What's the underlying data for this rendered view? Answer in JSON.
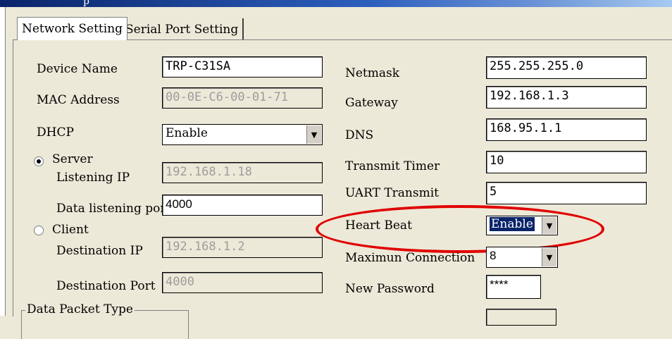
{
  "window": {
    "title_glyph": "p"
  },
  "tabs": [
    {
      "label": "Network Setting",
      "active": true
    },
    {
      "label": "Serial Port Setting",
      "active": false
    }
  ],
  "left": {
    "device_name": {
      "label": "Device Name",
      "value": "TRP-C31SA"
    },
    "mac_address": {
      "label": "MAC Address",
      "value": "00-0E-C6-00-01-71"
    },
    "dhcp": {
      "label": "DHCP",
      "value": "Enable"
    },
    "server": {
      "label": "Server",
      "selected": true
    },
    "listening_ip": {
      "label": "Listening IP",
      "value": "192.168.1.18"
    },
    "data_listening_port": {
      "label": "Data listening port",
      "value": "4000"
    },
    "client": {
      "label": "Client",
      "selected": false
    },
    "destination_ip": {
      "label": "Destination IP",
      "value": "192.168.1.2"
    },
    "destination_port": {
      "label": "Destination Port",
      "value": "4000"
    },
    "data_packet_type": {
      "label": "Data Packet Type"
    }
  },
  "right": {
    "netmask": {
      "label": "Netmask",
      "value": "255.255.255.0"
    },
    "gateway": {
      "label": "Gateway",
      "value": "192.168.1.3"
    },
    "dns": {
      "label": "DNS",
      "value": "168.95.1.1"
    },
    "transmit_timer": {
      "label": "Transmit Timer",
      "value": "10"
    },
    "uart_transmit": {
      "label": "UART Transmit",
      "value": "5"
    },
    "heart_beat": {
      "label": "Heart Beat",
      "value": "Enable"
    },
    "maximum_connection": {
      "label": "Maximun Connection",
      "value": "8"
    },
    "new_password": {
      "label": "New Password",
      "value": "****"
    }
  },
  "colors": {
    "highlight_ellipse": "#e00000",
    "selection": "#0a246a",
    "dialog_bg": "#ece9d8"
  }
}
